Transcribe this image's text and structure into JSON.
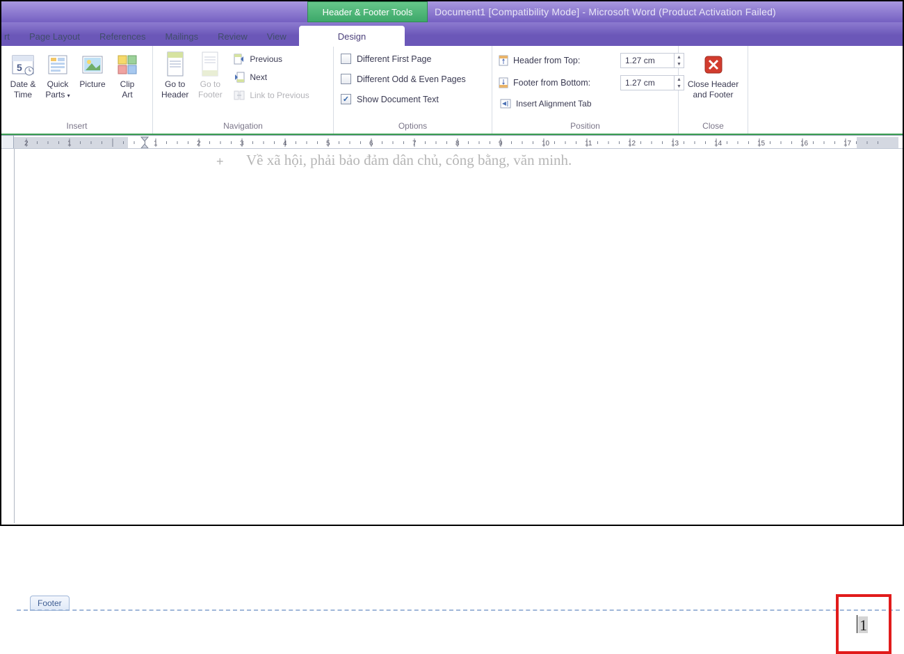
{
  "title": {
    "context_tab": "Header & Footer Tools",
    "document_title": "Document1 [Compatibility Mode] - Microsoft Word (Product Activation Failed)"
  },
  "tabs": {
    "items": [
      "rt",
      "Page Layout",
      "References",
      "Mailings",
      "Review",
      "View"
    ],
    "active": "Design"
  },
  "ribbon": {
    "insert": {
      "label": "Insert",
      "date_time": "Date &\nTime",
      "quick_parts": "Quick\nParts",
      "picture": "Picture",
      "clip_art": "Clip\nArt"
    },
    "navigation": {
      "label": "Navigation",
      "goto_header": "Go to\nHeader",
      "goto_footer": "Go to\nFooter",
      "previous": "Previous",
      "next": "Next",
      "link_prev": "Link to Previous"
    },
    "options": {
      "label": "Options",
      "diff_first": "Different First Page",
      "diff_odd_even": "Different Odd & Even Pages",
      "show_doc": "Show Document Text",
      "diff_first_checked": false,
      "diff_odd_even_checked": false,
      "show_doc_checked": true
    },
    "position": {
      "label": "Position",
      "header_from_top": "Header from Top:",
      "footer_from_bottom": "Footer from Bottom:",
      "insert_align_tab": "Insert Alignment Tab",
      "header_val": "1.27 cm",
      "footer_val": "1.27 cm"
    },
    "close": {
      "label": "Close",
      "close_hf": "Close Header\nand Footer"
    }
  },
  "ruler": {
    "ticks": [
      "2",
      "1",
      "",
      "1",
      "2",
      "3",
      "4",
      "5",
      "6",
      "7",
      "8",
      "9",
      "10",
      "11",
      "12",
      "13",
      "14",
      "15",
      "16",
      "17"
    ]
  },
  "document": {
    "body_text": "Về xã hội, phải bảo đảm dân chủ, công bằng, văn minh.",
    "footer_tab": "Footer",
    "page_number": "1"
  }
}
